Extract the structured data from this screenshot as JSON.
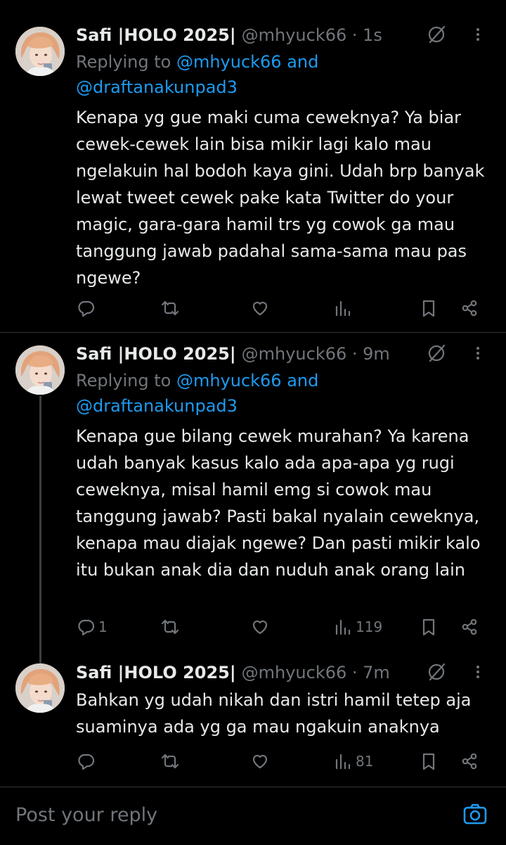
{
  "tweets": [
    {
      "name": "Safi |HOLO 2025|",
      "handle": "@mhyuck66 · 1s",
      "replying_prefix": "Replying to ",
      "replying_mention": "@mhyuck66 and @draftanakunpad3",
      "text": "Kenapa yg gue maki cuma ceweknya? Ya biar cewek-cewek lain bisa mikir lagi kalo mau ngelakuin hal bodoh kaya gini. Udah brp banyak lewat tweet cewek pake kata Twitter do your magic, gara-gara hamil trs yg cowok ga mau tanggung jawab padahal sama-sama mau pas ngewe?",
      "replies": "",
      "views": ""
    },
    {
      "name": "Safi |HOLO 2025|",
      "handle": "@mhyuck66 · 9m",
      "replying_prefix": "Replying to ",
      "replying_mention": "@mhyuck66 and @draftanakunpad3",
      "text": "Kenapa gue bilang cewek murahan? Ya karena udah banyak kasus kalo ada apa-apa yg rugi ceweknya, misal hamil emg si cowok mau tanggung jawab? Pasti bakal nyalain ceweknya, kenapa mau diajak ngewe? Dan pasti mikir kalo itu bukan anak dia dan nuduh anak orang lain",
      "replies": "1",
      "views": "119"
    },
    {
      "name": "Safi |HOLO 2025|",
      "handle": "@mhyuck66 · 7m",
      "text": "Bahkan yg udah nikah dan istri hamil tetep aja suaminya ada yg ga mau ngakuin anaknya",
      "replies": "",
      "views": "81"
    }
  ],
  "compose": {
    "placeholder": "Post your reply"
  },
  "colors": {
    "background": "#000000",
    "text": "#e7e9ea",
    "muted": "#71767b",
    "accent": "#1d9bf0",
    "divider": "#2f3336"
  },
  "icons": [
    "avatar-photo",
    "grok-icon",
    "more-icon",
    "reply-icon",
    "repost-icon",
    "like-icon",
    "views-icon",
    "bookmark-icon",
    "share-icon",
    "camera-icon"
  ]
}
